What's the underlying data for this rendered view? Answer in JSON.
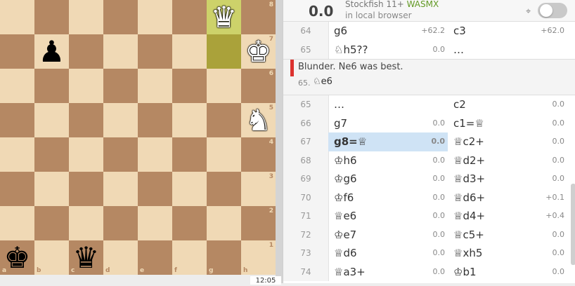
{
  "board": {
    "files": [
      "a",
      "b",
      "c",
      "d",
      "e",
      "f",
      "g",
      "h"
    ],
    "ranks": [
      "8",
      "7",
      "6",
      "5",
      "4",
      "3",
      "2",
      "1"
    ],
    "highlight": [
      "g8",
      "g7"
    ],
    "pieces": [
      {
        "square": "g8",
        "glyph": "♛",
        "color": "white",
        "name": "white-queen"
      },
      {
        "square": "h7",
        "glyph": "♚",
        "color": "white",
        "name": "white-king"
      },
      {
        "square": "b7",
        "glyph": "♟",
        "color": "black",
        "name": "black-pawn"
      },
      {
        "square": "h5",
        "glyph": "♞",
        "color": "white",
        "name": "white-knight"
      },
      {
        "square": "a1",
        "glyph": "♚",
        "color": "black",
        "name": "black-king"
      },
      {
        "square": "c1",
        "glyph": "♛",
        "color": "black",
        "name": "black-queen"
      }
    ],
    "clock_partial": "12:05"
  },
  "engine": {
    "eval": "0.0",
    "name": "Stockfish 11+",
    "mode": "WASMX",
    "location": "in local browser"
  },
  "moves_top": [
    {
      "num": "64",
      "white": "g6",
      "white_eval": "+62.2",
      "black": "c3",
      "black_eval": "+62.0"
    },
    {
      "num": "65",
      "white": "♘h5??",
      "white_eval": "0.0",
      "black": "…",
      "black_eval": ""
    }
  ],
  "comment": {
    "text": "Blunder. Ne6 was best.",
    "move_num": "65.",
    "move": "♘e6"
  },
  "moves_bottom": [
    {
      "num": "65",
      "white": "…",
      "white_eval": "",
      "black": "c2",
      "black_eval": "0.0",
      "active": false
    },
    {
      "num": "66",
      "white": "g7",
      "white_eval": "0.0",
      "black": "c1=♕",
      "black_eval": "0.0",
      "active": false
    },
    {
      "num": "67",
      "white": "g8=♕",
      "white_eval": "0.0",
      "black": "♕c2+",
      "black_eval": "0.0",
      "active": true
    },
    {
      "num": "68",
      "white": "♔h6",
      "white_eval": "0.0",
      "black": "♕d2+",
      "black_eval": "0.0",
      "active": false
    },
    {
      "num": "69",
      "white": "♔g6",
      "white_eval": "0.0",
      "black": "♕d3+",
      "black_eval": "0.0",
      "active": false
    },
    {
      "num": "70",
      "white": "♔f6",
      "white_eval": "0.0",
      "black": "♕d6+",
      "black_eval": "+0.1",
      "active": false
    },
    {
      "num": "71",
      "white": "♕e6",
      "white_eval": "0.0",
      "black": "♕d4+",
      "black_eval": "+0.4",
      "active": false
    },
    {
      "num": "72",
      "white": "♔e7",
      "white_eval": "0.0",
      "black": "♕c5+",
      "black_eval": "0.0",
      "active": false
    },
    {
      "num": "73",
      "white": "♕d6",
      "white_eval": "0.0",
      "black": "♕xh5",
      "black_eval": "0.0",
      "active": false
    },
    {
      "num": "74",
      "white": "♕a3+",
      "white_eval": "0.0",
      "black": "♔b1",
      "black_eval": "0.0",
      "active": false
    }
  ]
}
